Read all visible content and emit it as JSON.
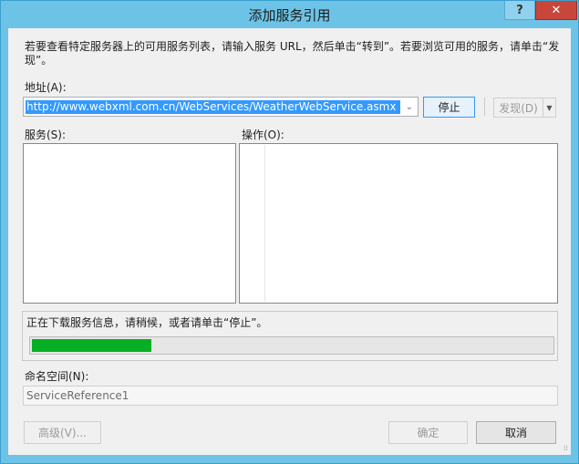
{
  "window": {
    "title": "添加服务引用",
    "help_glyph": "?",
    "close_glyph": "✕"
  },
  "dialog": {
    "description": "若要查看特定服务器上的可用服务列表，请输入服务 URL，然后单击“转到”。若要浏览可用的服务，请单击“发现”。",
    "address_label": "地址(A):",
    "address_value": "http://www.webxml.com.cn/WebServices/WeatherWebService.asmx",
    "stop_label": "停止",
    "discover_label": "发现(D)",
    "services_label": "服务(S):",
    "operations_label": "操作(O):",
    "status_text": "正在下载服务信息，请稍候，或者请单击“停止”。",
    "progress": 0.23,
    "namespace_label": "命名空间(N):",
    "namespace_value": "ServiceReference1",
    "advanced_label": "高级(V)...",
    "ok_label": "确定",
    "cancel_label": "取消"
  },
  "icons": {
    "dropdown": "chevron-down-icon",
    "split_arrow": "triangle-down-icon",
    "resize": "resize-grip-icon"
  },
  "colors": {
    "title_bar": "#6cc3e6",
    "close_button": "#c8473a",
    "selection": "#3399ff",
    "progress_fill": "#06b025"
  }
}
